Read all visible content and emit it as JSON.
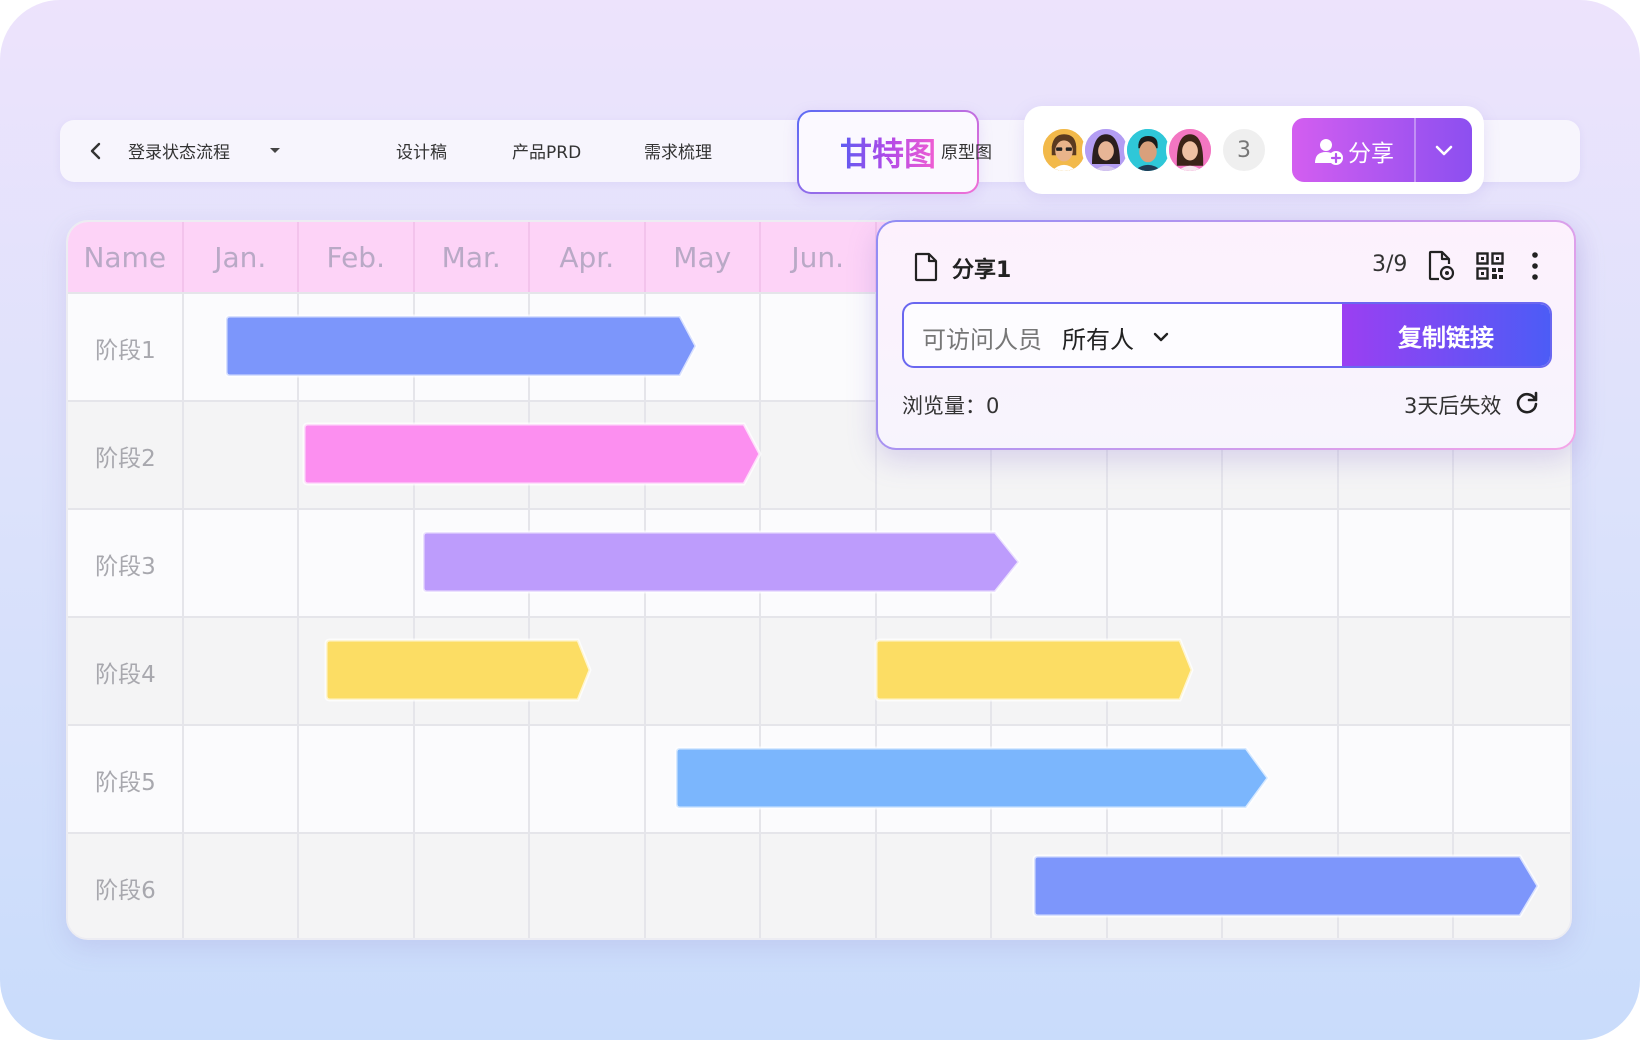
{
  "topbar": {
    "doc_title": "登录状态流程",
    "tabs": [
      {
        "label": "设计稿"
      },
      {
        "label": "产品PRD"
      },
      {
        "label": "需求梳理"
      },
      {
        "label": "甘特图",
        "active": true
      },
      {
        "label": "原型图"
      }
    ]
  },
  "collaborators": {
    "avatars": [
      "avatar-1",
      "avatar-2",
      "avatar-3",
      "avatar-4"
    ],
    "extra_count": "3"
  },
  "share_button": {
    "label": "分享"
  },
  "gantt": {
    "header": [
      "Name",
      "Jan.",
      "Feb.",
      "Mar.",
      "Apr.",
      "May",
      "Jun."
    ],
    "rows": [
      {
        "label": "阶段1"
      },
      {
        "label": "阶段2"
      },
      {
        "label": "阶段3"
      },
      {
        "label": "阶段4"
      },
      {
        "label": "阶段5"
      },
      {
        "label": "阶段6"
      }
    ],
    "bar_colors": {
      "phase1": "#7c96fb",
      "phase2": "#fc8ff0",
      "phase3": "#bd9cfc",
      "phase4": "#fcdd64",
      "phase5": "#7bb6fd",
      "phase6": "#7d96fb"
    }
  },
  "share_popup": {
    "name": "分享1",
    "counter": "3/9",
    "access_label": "可访问人员",
    "access_value": "所有人",
    "copy_label": "复制链接",
    "views": "浏览量：0",
    "expiry": "3天后失效"
  },
  "colors": {
    "accent_purple": "#9b3ff2",
    "accent_blue": "#4c5cf6",
    "header_pink": "#fdd3f7"
  }
}
